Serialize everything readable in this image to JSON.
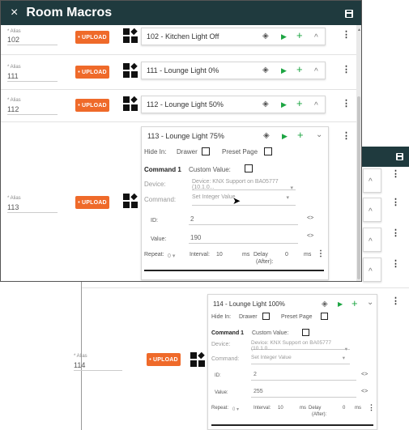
{
  "back": {
    "top_rows": [
      {
        "name": "back-row-chevron",
        "chev": "^"
      },
      {
        "name": "back-row-chevron",
        "chev": "^"
      },
      {
        "name": "back-row-chevron",
        "chev": "^"
      },
      {
        "name": "back-row-chevron",
        "chev": "^"
      }
    ],
    "kebab": "⋮",
    "save_icon": "save-icon",
    "alias_label": "* Alias",
    "alias_value": "114",
    "upload_label": "• UPLOAD",
    "macro": {
      "name": "114 - Lounge Light 100%",
      "hide_in_label": "Hide In:",
      "drawer_label": "Drawer",
      "preset_page_label": "Preset Page",
      "command_label": "Command 1",
      "custom_value_label": "Custom Value:",
      "device_label": "Device:",
      "device_value": "Device: KNX Support on BA05777 (10.1.0...",
      "command_field_label": "Command:",
      "command_value": "Set Integer Value",
      "id_label": "ID:",
      "id_value": "2",
      "value_label": "Value:",
      "value_value": "255",
      "repeat_label": "Repeat:",
      "repeat_value": "0",
      "interval_label": "Interval:",
      "interval_value": "10",
      "ms1": "ms",
      "delay_label": "Delay",
      "after_label": "(After):",
      "delay_value": "0",
      "ms2": "ms",
      "expand_chev": "⌄",
      "play": "▶",
      "plus": "+"
    }
  },
  "front": {
    "title": "Room Macros",
    "close": "×",
    "save_icon": "save-icon",
    "rows": [
      {
        "alias_label": "* Alias",
        "alias_value": "102",
        "upload": "• UPLOAD",
        "name": "102 - Kitchen Light Off",
        "chev": "^"
      },
      {
        "alias_label": "* Alias",
        "alias_value": "111",
        "upload": "• UPLOAD",
        "name": "111 - Lounge Light 0%",
        "chev": "^"
      },
      {
        "alias_label": "* Alias",
        "alias_value": "112",
        "upload": "• UPLOAD",
        "name": "112 - Lounge Light 50%",
        "chev": "^"
      },
      {
        "alias_label": "* Alias",
        "alias_value": "113",
        "upload": "• UPLOAD",
        "name": "113 - Lounge Light 75%",
        "chev": "⌄"
      }
    ],
    "kebab": "⋮",
    "play": "▶",
    "plus": "+",
    "expanded": {
      "hide_in_label": "Hide In:",
      "drawer_label": "Drawer",
      "preset_page_label": "Preset Page",
      "command_label": "Command 1",
      "custom_value_label": "Custom Value:",
      "device_label": "Device:",
      "device_value": "Device: KNX Support on BA05777 (10.1.0...",
      "command_field_label": "Command:",
      "command_value": "Set Integer Value",
      "id_label": "ID:",
      "id_value": "2",
      "value_label": "Value:",
      "value_value": "190",
      "repeat_label": "Repeat:",
      "repeat_value": "0",
      "interval_label": "Interval:",
      "interval_value": "10",
      "ms1": "ms",
      "delay_label": "Delay",
      "after_label": "(After):",
      "delay_value": "0",
      "ms2": "ms",
      "code_icon": "<>"
    }
  }
}
